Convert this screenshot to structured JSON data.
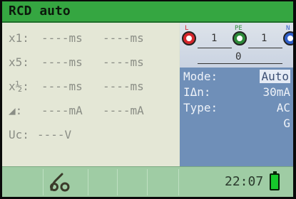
{
  "title": "RCD auto",
  "results": [
    {
      "label": "x1:",
      "value1": "----ms",
      "value2": "----ms"
    },
    {
      "label": "x5:",
      "value1": "----ms",
      "value2": "----ms"
    },
    {
      "label": "x½:",
      "value1": "----ms",
      "value2": "----ms"
    },
    {
      "label": "◢:",
      "value1": "----mA",
      "value2": "----mA"
    },
    {
      "label": "Uc:",
      "value1": "----V"
    }
  ],
  "terminals": {
    "L": {
      "label": "L",
      "color": "#d5262c"
    },
    "PE": {
      "label": "PE",
      "color": "#2e8a3a"
    },
    "N": {
      "label": "N",
      "color": "#2f5fc8"
    },
    "l_pe": "1",
    "pe_n": "1",
    "l_n": "0"
  },
  "params": {
    "mode": {
      "label": "Mode:",
      "value": "Auto"
    },
    "idn": {
      "label": "IΔn:",
      "value": "30mA"
    },
    "type": {
      "label": "Type:",
      "value": "AC"
    },
    "type2": "G"
  },
  "statusbar": {
    "time": "22:07",
    "icon": "probe-icon"
  }
}
